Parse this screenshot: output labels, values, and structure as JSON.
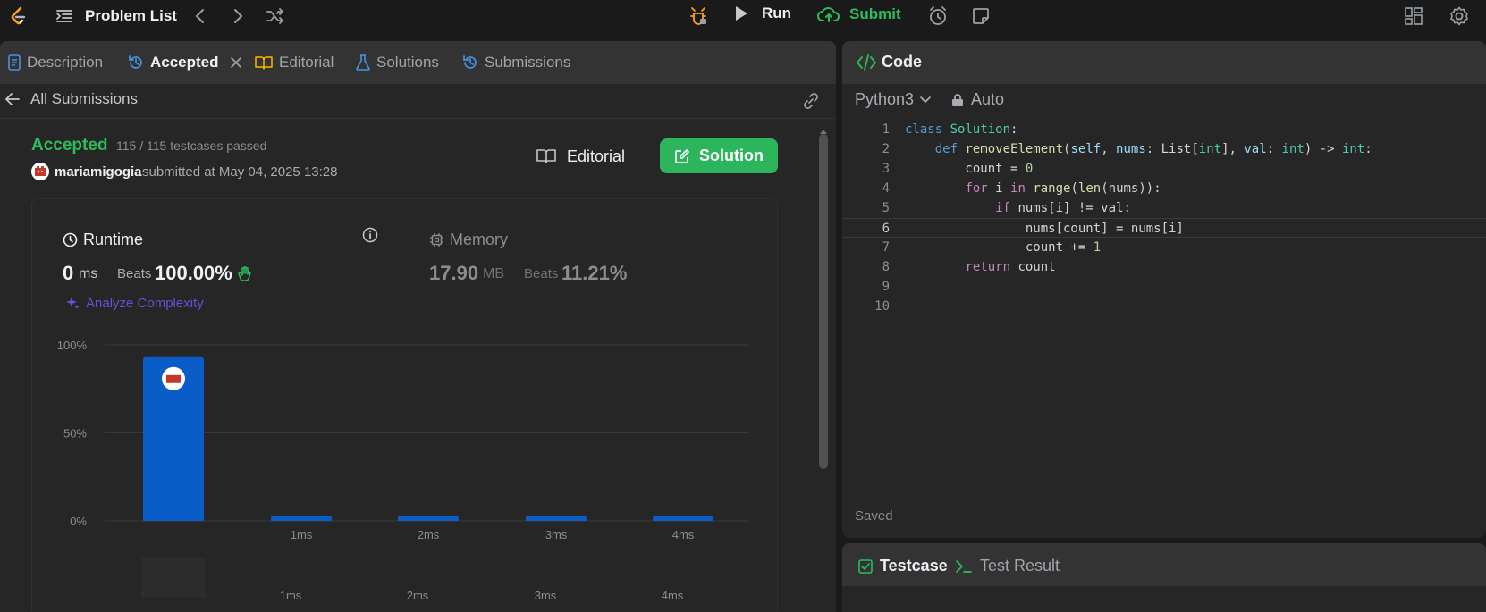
{
  "topbar": {
    "problem_list": "Problem List",
    "run": "Run",
    "submit": "Submit"
  },
  "tabs": {
    "description": "Description",
    "accepted": "Accepted",
    "editorial": "Editorial",
    "solutions": "Solutions",
    "submissions": "Submissions"
  },
  "submission": {
    "back": "All Submissions",
    "status": "Accepted",
    "testcases": "115 / 115 testcases passed",
    "user": "mariamigogia",
    "submitted_at": "submitted at May 04, 2025 13:28",
    "editorial_btn": "Editorial",
    "solution_btn": "Solution"
  },
  "stats": {
    "runtime_label": "Runtime",
    "runtime_value": "0",
    "runtime_unit": "ms",
    "beats_label": "Beats",
    "runtime_beats": "100.00%",
    "memory_label": "Memory",
    "memory_value": "17.90",
    "memory_unit": "MB",
    "memory_beats": "11.21%",
    "analyze": "Analyze Complexity"
  },
  "chart_data": {
    "type": "bar",
    "categories": [
      "",
      "1ms",
      "2ms",
      "3ms",
      "4ms"
    ],
    "values": [
      93,
      3,
      3,
      3,
      3
    ],
    "ylim": [
      0,
      100
    ],
    "yticks": [
      "100%",
      "50%",
      "0%"
    ],
    "bottom_labels": [
      "",
      "1ms",
      "2ms",
      "3ms",
      "4ms"
    ],
    "bar_color": "#0a5cc7"
  },
  "code_panel": {
    "title": "Code",
    "language": "Python3",
    "mode": "Auto",
    "saved": "Saved",
    "lines": [
      "1",
      "2",
      "3",
      "4",
      "5",
      "6",
      "7",
      "8",
      "9",
      "10"
    ]
  },
  "bottom": {
    "testcase": "Testcase",
    "test_result": "Test Result"
  },
  "colors": {
    "accent_green": "#2cbb5d",
    "submit_green": "#2cbb5d",
    "bar_blue": "#0a5cc7",
    "analyze_purple": "#6c4dd8"
  }
}
